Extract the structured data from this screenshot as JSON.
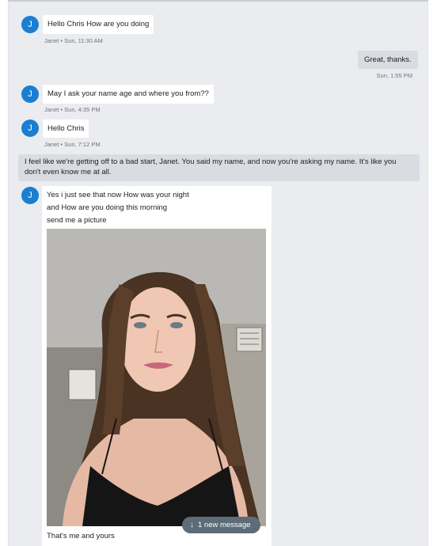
{
  "thread": {
    "messages": [
      {
        "avatar": "J",
        "text": "Hello Chris How are you doing",
        "meta": "Janet • Sun, 11:30 AM"
      },
      {
        "text": "Great, thanks.",
        "meta": "Sun, 1:55 PM"
      },
      {
        "avatar": "J",
        "text": "May I ask your name age and where you from??",
        "meta": "Janet • Sun, 4:35 PM"
      },
      {
        "avatar": "J",
        "text": "Hello Chris",
        "meta": "Janet • Sun, 7:12 PM"
      },
      {
        "lines": [
          "I feel like we're getting off to a bad start, Janet. You said my name, and now you're asking my name. It's like you",
          "don't even know me at all."
        ]
      },
      {
        "avatar": "J",
        "lines": [
          "Yes i just see that now How was your night",
          "and How are you doing this morning",
          "send me a picture"
        ],
        "caption": "That's me and yours"
      }
    ]
  },
  "new_message_pill": {
    "arrow": "↓",
    "label": "1 new message"
  },
  "colors": {
    "avatar": "#1a7fd1",
    "background": "#eaecef",
    "outgoing": "#d9dce1",
    "pill": "#5c6d78"
  }
}
